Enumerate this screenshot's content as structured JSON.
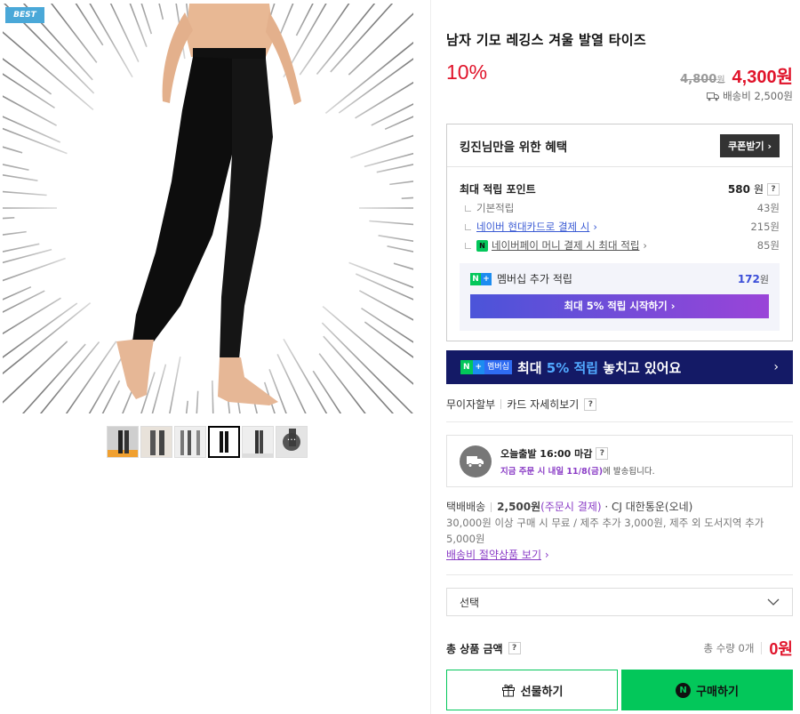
{
  "gallery": {
    "badge": "BEST",
    "more_label": "···",
    "thumbnails": [
      "thumb-1",
      "thumb-2",
      "thumb-3",
      "thumb-4",
      "thumb-5",
      "thumb-more"
    ]
  },
  "product": {
    "title": "남자 기모 레깅스 겨울 발열 타이즈",
    "discount": "10%",
    "original_price": "4,800",
    "original_unit": "원",
    "price": "4,300원",
    "shipping_fee": "배송비 2,500원"
  },
  "benefit": {
    "title": "킹진님만을 위한 혜택",
    "coupon_button": "쿠폰받기",
    "max_points_label": "최대 적립 포인트",
    "max_points_value": "580",
    "unit": "원",
    "rows": [
      {
        "label": "기본적립",
        "value": "43원"
      },
      {
        "label": "네이버 현대카드로 결제 시",
        "value": "215원"
      },
      {
        "label": "네이버페이 머니 결제 시 최대 적립",
        "value": "85원"
      }
    ],
    "membership_label": "멤버십 추가 적립",
    "membership_value": "172",
    "membership_button": "최대 5% 적립 시작하기",
    "npay_icon": "N"
  },
  "banner": {
    "badge_text": "멤버십",
    "text_pre": "최대 ",
    "text_highlight": "5% 적립",
    "text_post": " 놓치고 있어요"
  },
  "card": {
    "installment": "무이자할부",
    "details": "카드 자세히보기"
  },
  "delivery": {
    "line1": "오늘출발 16:00 마감",
    "line2_highlight": "지금 주문 시 내일 11/8(금)",
    "line2_rest": "에 발송됩니다."
  },
  "shipping": {
    "method": "택배배송",
    "fee": "2,500원",
    "pay_note": "(주문시 결제)",
    "carrier": " · CJ 대한통운(오네)",
    "free_note": "30,000원 이상 구매 시 무료 / 제주 추가 3,000원, 제주 외 도서지역 추가 5,000원",
    "saver_link": "배송비 절약상품 보기"
  },
  "option": {
    "select_placeholder": "선택"
  },
  "total": {
    "label": "총 상품 금액",
    "qty": "총 수량 0개",
    "amount": "0원"
  },
  "actions": {
    "gift": "선물하기",
    "buy": "구매하기"
  },
  "colors": {
    "accent_red": "#e0132a",
    "naver_green": "#03c75a",
    "membership_purple": "#8a3cc6"
  }
}
